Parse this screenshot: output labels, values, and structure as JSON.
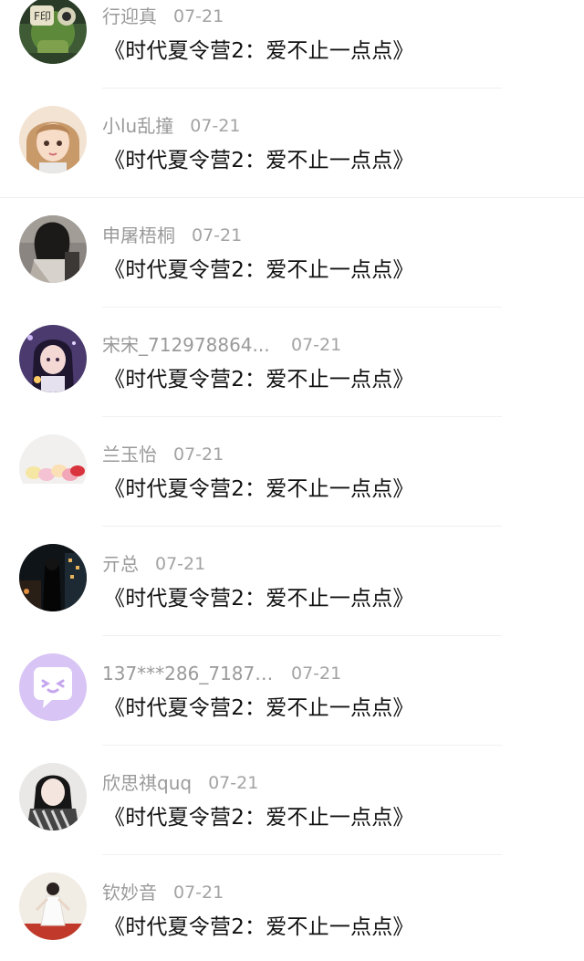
{
  "comments": [
    {
      "username": "行迎真",
      "date": "07-21",
      "text": "《时代夏令营2：爱不止一点点》",
      "avatar": "green-robot-avatar"
    },
    {
      "username": "小lu乱撞",
      "date": "07-21",
      "text": "《时代夏令营2：爱不止一点点》",
      "avatar": "cartoon-girl-avatar"
    },
    {
      "username": "申屠梧桐",
      "date": "07-21",
      "text": "《时代夏令营2：爱不止一点点》",
      "avatar": "dark-hair-girl-avatar"
    },
    {
      "username": "宋宋_712978864...",
      "date": "07-21",
      "text": "《时代夏令营2：爱不止一点点》",
      "avatar": "purple-anime-girl-avatar"
    },
    {
      "username": "兰玉怡",
      "date": "07-21",
      "text": "《时代夏令营2：爱不止一点点》",
      "avatar": "macarons-avatar"
    },
    {
      "username": "亓总",
      "date": "07-21",
      "text": "《时代夏令营2：爱不止一点点》",
      "avatar": "night-city-avatar"
    },
    {
      "username": "137***286_71875...",
      "date": "07-21",
      "text": "《时代夏令营2：爱不止一点点》",
      "avatar": "default-chat-bubble-avatar"
    },
    {
      "username": "欣思祺quq",
      "date": "07-21",
      "text": "《时代夏令营2：爱不止一点点》",
      "avatar": "scarf-girl-avatar"
    },
    {
      "username": "钦妙音",
      "date": "07-21",
      "text": "《时代夏令营2：爱不止一点点》",
      "avatar": "white-dress-girl-avatar"
    }
  ]
}
